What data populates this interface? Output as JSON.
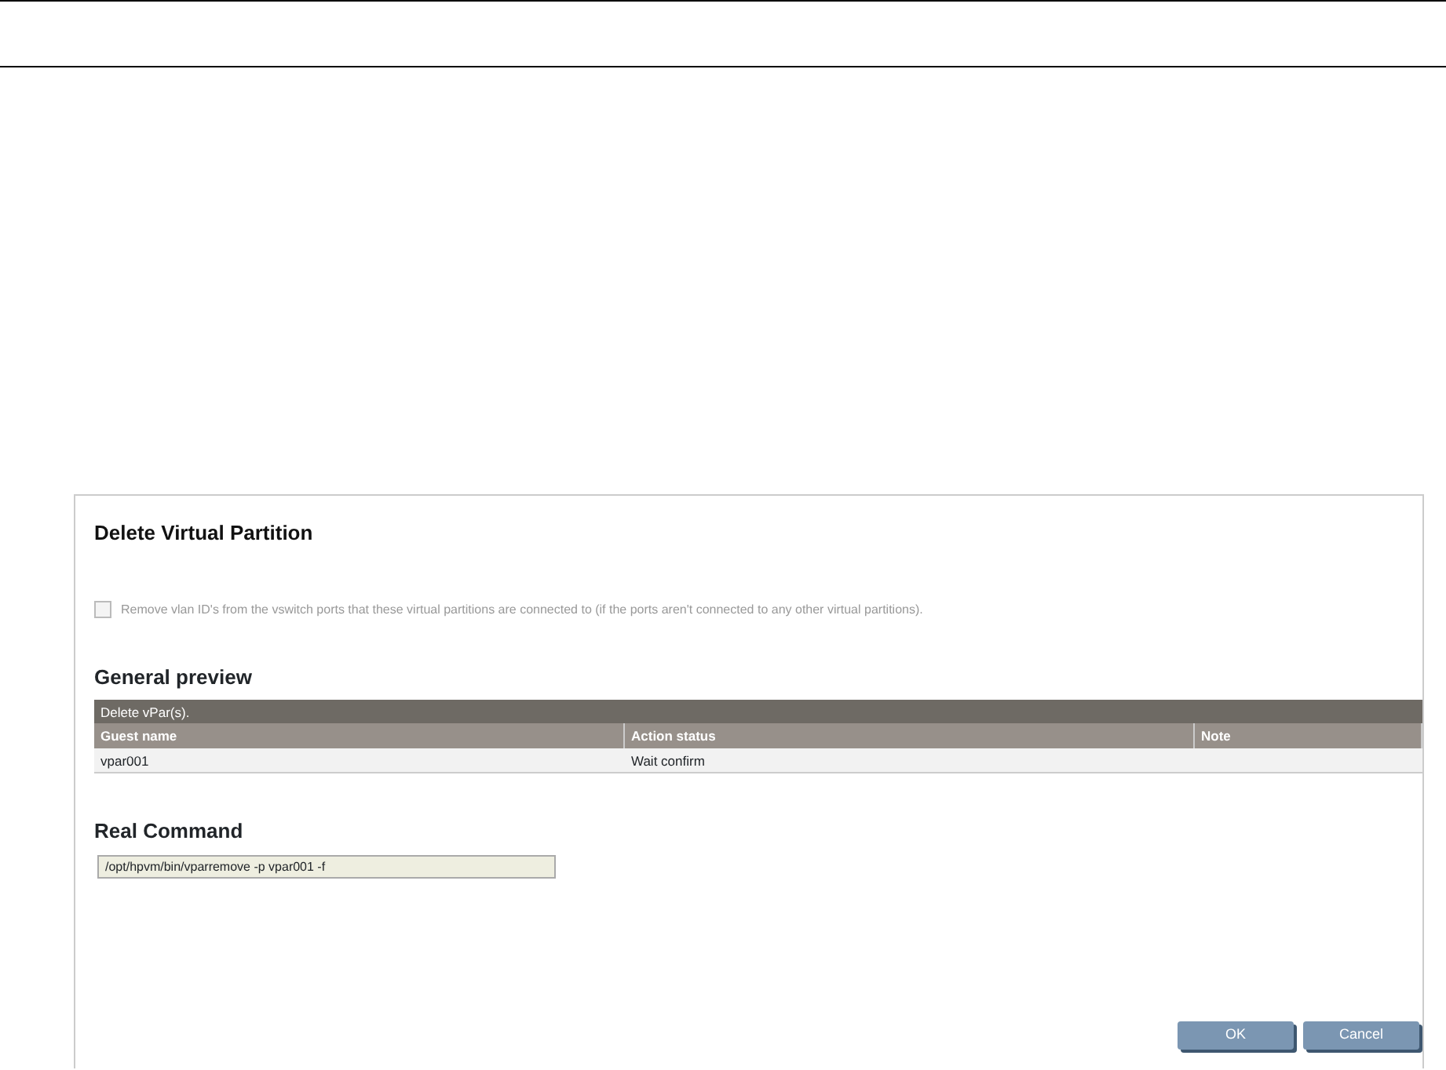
{
  "dialog": {
    "title": "Delete Virtual Partition",
    "option": {
      "label": "Remove vlan ID's from the vswitch ports that these virtual partitions are connected to (if the ports aren't connected to any other virtual partitions).",
      "checked": false,
      "disabled": true
    },
    "preview": {
      "heading": "General preview",
      "table": {
        "caption": "Delete vPar(s).",
        "columns": [
          "Guest name",
          "Action status",
          "Note"
        ],
        "rows": [
          [
            "vpar001",
            "Wait confirm",
            ""
          ]
        ]
      }
    },
    "command": {
      "heading": "Real Command",
      "value": "/opt/hpvm/bin/vparremove -p vpar001 -f"
    },
    "buttons": [
      "OK",
      "Cancel"
    ]
  }
}
